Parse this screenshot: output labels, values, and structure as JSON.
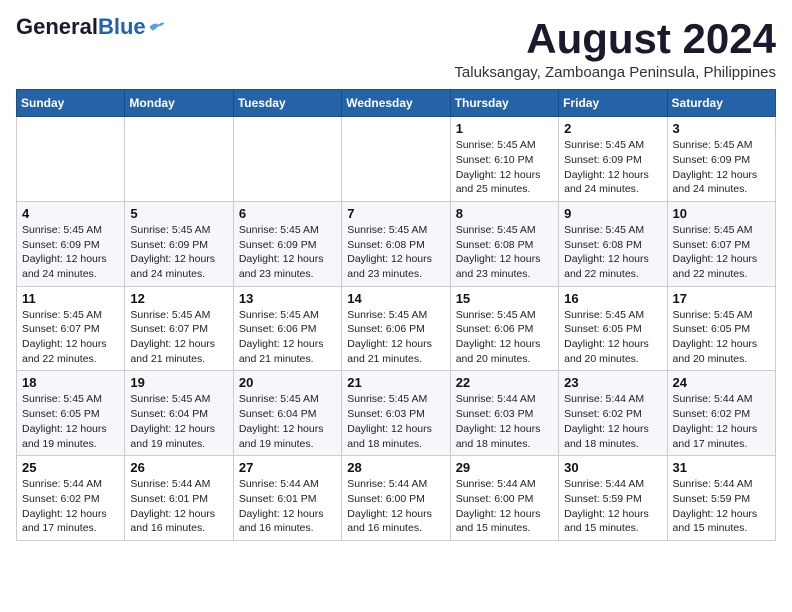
{
  "header": {
    "logo_general": "General",
    "logo_blue": "Blue",
    "title": "August 2024",
    "subtitle": "Taluksangay, Zamboanga Peninsula, Philippines"
  },
  "weekdays": [
    "Sunday",
    "Monday",
    "Tuesday",
    "Wednesday",
    "Thursday",
    "Friday",
    "Saturday"
  ],
  "weeks": [
    [
      {
        "day": "",
        "info": ""
      },
      {
        "day": "",
        "info": ""
      },
      {
        "day": "",
        "info": ""
      },
      {
        "day": "",
        "info": ""
      },
      {
        "day": "1",
        "info": "Sunrise: 5:45 AM\nSunset: 6:10 PM\nDaylight: 12 hours\nand 25 minutes."
      },
      {
        "day": "2",
        "info": "Sunrise: 5:45 AM\nSunset: 6:09 PM\nDaylight: 12 hours\nand 24 minutes."
      },
      {
        "day": "3",
        "info": "Sunrise: 5:45 AM\nSunset: 6:09 PM\nDaylight: 12 hours\nand 24 minutes."
      }
    ],
    [
      {
        "day": "4",
        "info": "Sunrise: 5:45 AM\nSunset: 6:09 PM\nDaylight: 12 hours\nand 24 minutes."
      },
      {
        "day": "5",
        "info": "Sunrise: 5:45 AM\nSunset: 6:09 PM\nDaylight: 12 hours\nand 24 minutes."
      },
      {
        "day": "6",
        "info": "Sunrise: 5:45 AM\nSunset: 6:09 PM\nDaylight: 12 hours\nand 23 minutes."
      },
      {
        "day": "7",
        "info": "Sunrise: 5:45 AM\nSunset: 6:08 PM\nDaylight: 12 hours\nand 23 minutes."
      },
      {
        "day": "8",
        "info": "Sunrise: 5:45 AM\nSunset: 6:08 PM\nDaylight: 12 hours\nand 23 minutes."
      },
      {
        "day": "9",
        "info": "Sunrise: 5:45 AM\nSunset: 6:08 PM\nDaylight: 12 hours\nand 22 minutes."
      },
      {
        "day": "10",
        "info": "Sunrise: 5:45 AM\nSunset: 6:07 PM\nDaylight: 12 hours\nand 22 minutes."
      }
    ],
    [
      {
        "day": "11",
        "info": "Sunrise: 5:45 AM\nSunset: 6:07 PM\nDaylight: 12 hours\nand 22 minutes."
      },
      {
        "day": "12",
        "info": "Sunrise: 5:45 AM\nSunset: 6:07 PM\nDaylight: 12 hours\nand 21 minutes."
      },
      {
        "day": "13",
        "info": "Sunrise: 5:45 AM\nSunset: 6:06 PM\nDaylight: 12 hours\nand 21 minutes."
      },
      {
        "day": "14",
        "info": "Sunrise: 5:45 AM\nSunset: 6:06 PM\nDaylight: 12 hours\nand 21 minutes."
      },
      {
        "day": "15",
        "info": "Sunrise: 5:45 AM\nSunset: 6:06 PM\nDaylight: 12 hours\nand 20 minutes."
      },
      {
        "day": "16",
        "info": "Sunrise: 5:45 AM\nSunset: 6:05 PM\nDaylight: 12 hours\nand 20 minutes."
      },
      {
        "day": "17",
        "info": "Sunrise: 5:45 AM\nSunset: 6:05 PM\nDaylight: 12 hours\nand 20 minutes."
      }
    ],
    [
      {
        "day": "18",
        "info": "Sunrise: 5:45 AM\nSunset: 6:05 PM\nDaylight: 12 hours\nand 19 minutes."
      },
      {
        "day": "19",
        "info": "Sunrise: 5:45 AM\nSunset: 6:04 PM\nDaylight: 12 hours\nand 19 minutes."
      },
      {
        "day": "20",
        "info": "Sunrise: 5:45 AM\nSunset: 6:04 PM\nDaylight: 12 hours\nand 19 minutes."
      },
      {
        "day": "21",
        "info": "Sunrise: 5:45 AM\nSunset: 6:03 PM\nDaylight: 12 hours\nand 18 minutes."
      },
      {
        "day": "22",
        "info": "Sunrise: 5:44 AM\nSunset: 6:03 PM\nDaylight: 12 hours\nand 18 minutes."
      },
      {
        "day": "23",
        "info": "Sunrise: 5:44 AM\nSunset: 6:02 PM\nDaylight: 12 hours\nand 18 minutes."
      },
      {
        "day": "24",
        "info": "Sunrise: 5:44 AM\nSunset: 6:02 PM\nDaylight: 12 hours\nand 17 minutes."
      }
    ],
    [
      {
        "day": "25",
        "info": "Sunrise: 5:44 AM\nSunset: 6:02 PM\nDaylight: 12 hours\nand 17 minutes."
      },
      {
        "day": "26",
        "info": "Sunrise: 5:44 AM\nSunset: 6:01 PM\nDaylight: 12 hours\nand 16 minutes."
      },
      {
        "day": "27",
        "info": "Sunrise: 5:44 AM\nSunset: 6:01 PM\nDaylight: 12 hours\nand 16 minutes."
      },
      {
        "day": "28",
        "info": "Sunrise: 5:44 AM\nSunset: 6:00 PM\nDaylight: 12 hours\nand 16 minutes."
      },
      {
        "day": "29",
        "info": "Sunrise: 5:44 AM\nSunset: 6:00 PM\nDaylight: 12 hours\nand 15 minutes."
      },
      {
        "day": "30",
        "info": "Sunrise: 5:44 AM\nSunset: 5:59 PM\nDaylight: 12 hours\nand 15 minutes."
      },
      {
        "day": "31",
        "info": "Sunrise: 5:44 AM\nSunset: 5:59 PM\nDaylight: 12 hours\nand 15 minutes."
      }
    ]
  ]
}
